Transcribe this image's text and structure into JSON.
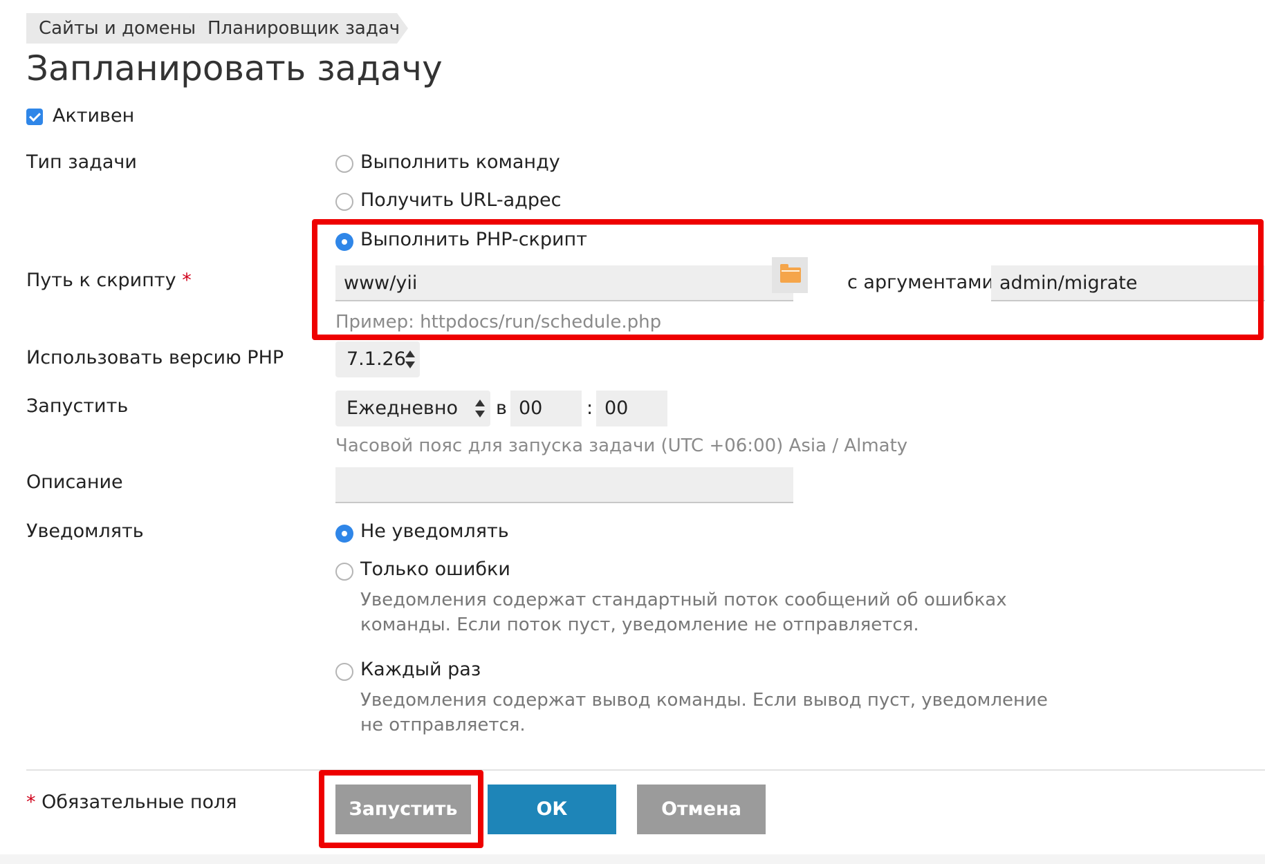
{
  "breadcrumb": [
    "Сайты и домены",
    "Планировщик задач"
  ],
  "title": "Запланировать задачу",
  "active": {
    "label": "Активен",
    "checked": true
  },
  "task_type": {
    "label": "Тип задачи",
    "options": [
      "Выполнить команду",
      "Получить URL-адрес",
      "Выполнить PHP-скрипт"
    ],
    "selected": "Выполнить PHP-скрипт"
  },
  "script_path": {
    "label": "Путь к скрипту",
    "required_mark": "*",
    "value": "www/yii",
    "args_label": "с аргументами",
    "args_value": "admin/migrate",
    "hint": "Пример: httpdocs/run/schedule.php"
  },
  "php_version": {
    "label": "Использовать версию PHP",
    "value": "7.1.26"
  },
  "run": {
    "label": "Запустить",
    "frequency": "Ежедневно",
    "at_label": "в",
    "hour": "00",
    "separator": ":",
    "minute": "00",
    "timezone_hint": "Часовой пояс для запуска задачи (UTC +06:00) Asia / Almaty"
  },
  "description": {
    "label": "Описание",
    "value": ""
  },
  "notify": {
    "label": "Уведомлять",
    "options": [
      {
        "label": "Не уведомлять",
        "desc": ""
      },
      {
        "label": "Только ошибки",
        "desc": "Уведомления содержат стандартный поток сообщений об ошибках команды. Если поток пуст, уведомление не отправляется."
      },
      {
        "label": "Каждый раз",
        "desc": "Уведомления содержат вывод команды. Если вывод пуст, уведомление не отправляется."
      }
    ],
    "selected": "Не уведомлять"
  },
  "footer": {
    "required_mark": "*",
    "required_note": "Обязательные поля",
    "run_button": "Запустить",
    "ok_button": "ОК",
    "cancel_button": "Отмена"
  },
  "colors": {
    "accent": "#2f86e8",
    "ok": "#1e85b8",
    "gray_button": "#9b9b9b",
    "highlight": "#ee0000"
  }
}
